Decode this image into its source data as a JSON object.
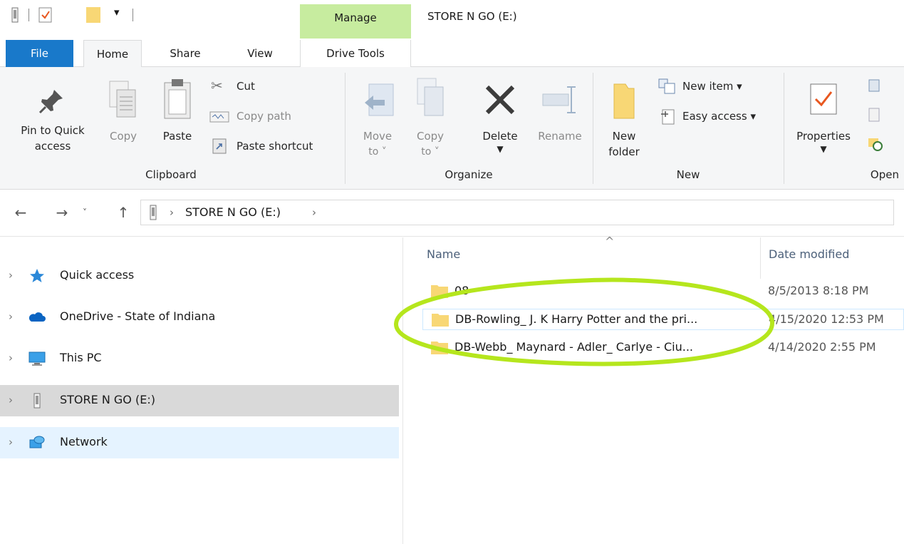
{
  "window": {
    "title": "STORE N GO (E:)",
    "context_tab_group": "Manage"
  },
  "tabs": [
    {
      "label": "File"
    },
    {
      "label": "Home"
    },
    {
      "label": "Share"
    },
    {
      "label": "View"
    },
    {
      "label": "Drive Tools"
    }
  ],
  "ribbon": {
    "clipboard": {
      "group_label": "Clipboard",
      "pin_line1": "Pin to Quick",
      "pin_line2": "access",
      "copy": "Copy",
      "paste": "Paste",
      "cut": "Cut",
      "copy_path": "Copy path",
      "paste_shortcut": "Paste shortcut"
    },
    "organize": {
      "group_label": "Organize",
      "move_line1": "Move",
      "move_line2": "to",
      "copy_line1": "Copy",
      "copy_line2": "to",
      "delete": "Delete",
      "rename": "Rename"
    },
    "new": {
      "group_label": "New",
      "new_folder_line1": "New",
      "new_folder_line2": "folder",
      "new_item": "New item",
      "easy_access": "Easy access"
    },
    "open": {
      "group_label": "Open",
      "properties": "Properties"
    }
  },
  "address": {
    "crumb": "STORE N GO (E:)"
  },
  "nav": {
    "items": [
      {
        "label": "Quick access"
      },
      {
        "label": "OneDrive - State of Indiana"
      },
      {
        "label": "This PC"
      },
      {
        "label": "STORE N GO (E:)"
      },
      {
        "label": "Network"
      }
    ]
  },
  "files": {
    "headers": {
      "name": "Name",
      "date": "Date modified"
    },
    "rows": [
      {
        "name": "08",
        "date": "8/5/2013 8:18 PM"
      },
      {
        "name": "DB-Rowling_ J. K Harry Potter and the pri...",
        "date": "4/15/2020 12:53 PM"
      },
      {
        "name": "DB-Webb_ Maynard - Adler_ Carlye - Ciu...",
        "date": "4/14/2020 2:55 PM"
      }
    ]
  },
  "colors": {
    "file_tab": "#1979ca",
    "manage_context": "#c7ec9f",
    "selected_nav": "#d9d9d9",
    "hover_nav": "#e5f3ff",
    "annotation": "#b5e61d",
    "folder": "#f8d775"
  }
}
